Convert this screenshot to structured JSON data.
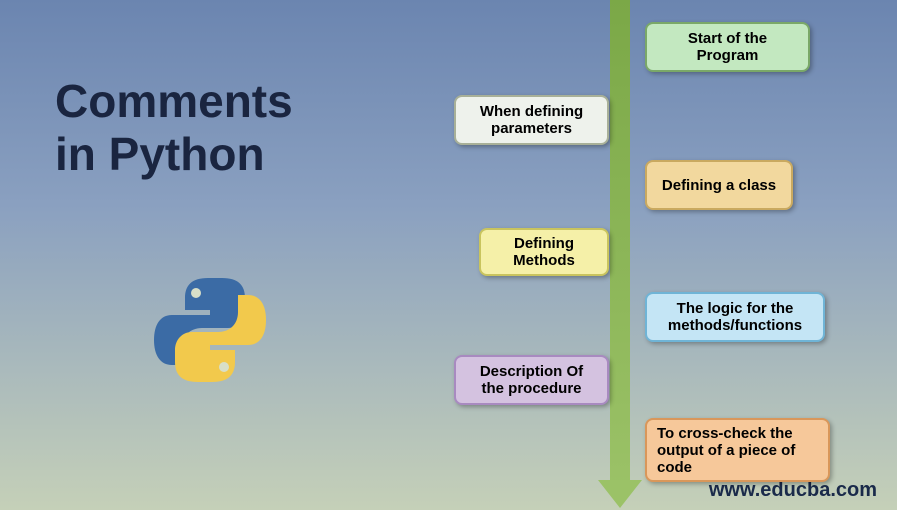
{
  "title_line1": "Comments",
  "title_line2": "in Python",
  "boxes": {
    "b1": "Start of the Program",
    "b2": "When defining parameters",
    "b3": "Defining a class",
    "b4": "Defining Methods",
    "b5": "The logic for the methods/functions",
    "b6": "Description Of the procedure",
    "b7": "To cross-check the output of a piece of code"
  },
  "footer": "www.educba.com"
}
